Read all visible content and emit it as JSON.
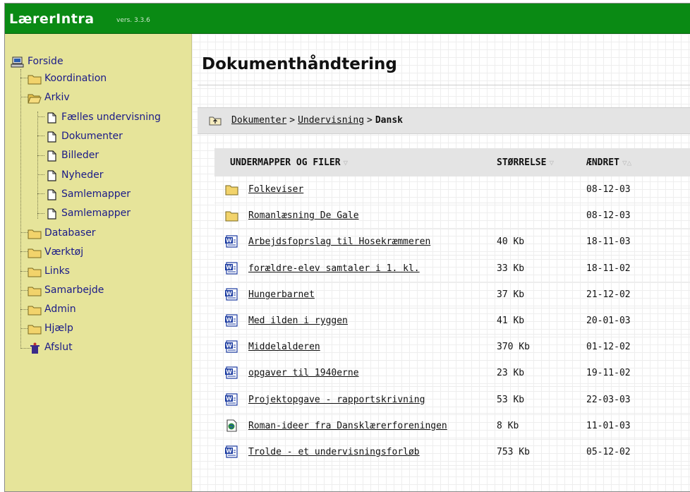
{
  "app": {
    "name": "LærerIntra",
    "version": "vers. 3.3.6"
  },
  "sidebar": {
    "items": [
      {
        "label": "Forside"
      },
      {
        "label": "Koordination"
      },
      {
        "label": "Arkiv"
      },
      {
        "label": "Fælles undervisning"
      },
      {
        "label": "Dokumenter"
      },
      {
        "label": "Billeder"
      },
      {
        "label": "Nyheder"
      },
      {
        "label": "Samlemapper"
      },
      {
        "label": "Samlemapper"
      },
      {
        "label": "Databaser"
      },
      {
        "label": "Værktøj"
      },
      {
        "label": "Links"
      },
      {
        "label": "Samarbejde"
      },
      {
        "label": "Admin"
      },
      {
        "label": "Hjælp"
      },
      {
        "label": "Afslut"
      }
    ]
  },
  "page": {
    "title": "Dokumenthåndtering"
  },
  "breadcrumb": {
    "items": [
      "Dokumenter",
      "Undervisning"
    ],
    "separator": ">",
    "current": "Dansk"
  },
  "table": {
    "columns": [
      {
        "label": "UNDERMAPPER OG FILER",
        "sort": "▽"
      },
      {
        "label": "STØRRELSE",
        "sort": "▽"
      },
      {
        "label": "ÆNDRET",
        "sort": "▽△"
      }
    ],
    "rows": [
      {
        "type": "folder",
        "name": "Folkeviser",
        "size": "",
        "date": "08-12-03"
      },
      {
        "type": "folder",
        "name": "Romanlæsning De Gale",
        "size": "",
        "date": "08-12-03"
      },
      {
        "type": "word",
        "name": "Arbejdsfoprslag til Hosekræmmeren",
        "size": "40 Kb",
        "date": "18-11-03"
      },
      {
        "type": "word",
        "name": "forældre-elev samtaler i 1. kl.",
        "size": "33 Kb",
        "date": "18-11-02"
      },
      {
        "type": "word",
        "name": "Hungerbarnet",
        "size": "37 Kb",
        "date": "21-12-02"
      },
      {
        "type": "word",
        "name": "Med ilden i ryggen",
        "size": "41 Kb",
        "date": "20-01-03"
      },
      {
        "type": "word",
        "name": "Middelalderen",
        "size": "370 Kb",
        "date": "01-12-02"
      },
      {
        "type": "word",
        "name": "opgaver til 1940erne",
        "size": "23 Kb",
        "date": "19-11-02"
      },
      {
        "type": "word",
        "name": "Projektopgave - rapportskrivning",
        "size": "53 Kb",
        "date": "22-03-03"
      },
      {
        "type": "web",
        "name": "Roman-ideer fra Dansklærerforeningen",
        "size": "8 Kb",
        "date": "11-01-03"
      },
      {
        "type": "word",
        "name": "Trolde - et undervisningsforløb",
        "size": "753 Kb",
        "date": "05-12-02"
      }
    ]
  },
  "colors": {
    "topbar": "#0a8a14",
    "sidebar": "#e6e49a",
    "tree_text": "#1a1a88",
    "header_bg": "#e4e4e4",
    "folder": "#f2d36b"
  }
}
